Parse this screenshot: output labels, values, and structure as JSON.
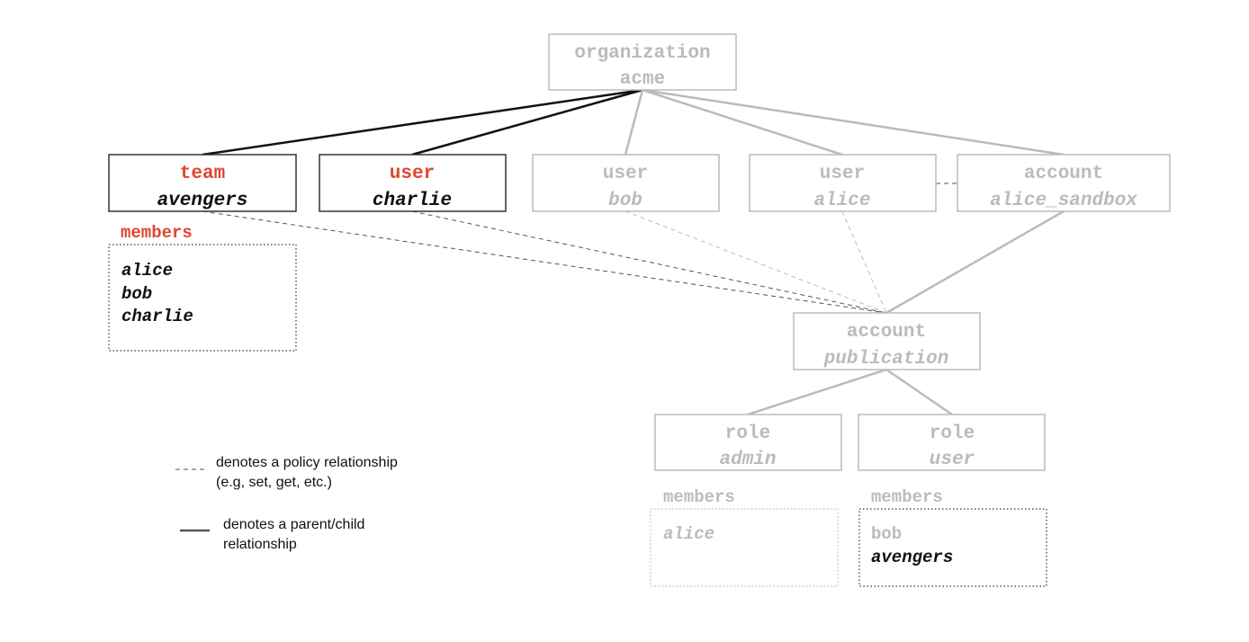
{
  "colors": {
    "accent": "#e0452f",
    "active": "#111111",
    "inactive": "#bbbbbb"
  },
  "nodes": {
    "organization": {
      "type": "organization",
      "name": "acme"
    },
    "team_avengers": {
      "type": "team",
      "name": "avengers",
      "members_label": "members",
      "members": [
        "alice",
        "bob",
        "charlie"
      ]
    },
    "user_charlie": {
      "type": "user",
      "name": "charlie"
    },
    "user_bob": {
      "type": "user",
      "name": "bob"
    },
    "user_alice": {
      "type": "user",
      "name": "alice"
    },
    "account_sandbox": {
      "type": "account",
      "name": "alice_sandbox"
    },
    "account_publication": {
      "type": "account",
      "name": "publication"
    },
    "role_admin": {
      "type": "role",
      "name": "admin",
      "members_label": "members",
      "members": [
        "alice"
      ]
    },
    "role_user": {
      "type": "role",
      "name": "user",
      "members_label": "members",
      "members": [
        "bob",
        "avengers"
      ]
    }
  },
  "legend": {
    "policy": [
      "denotes a policy relationship",
      "(e.g, set, get, etc.)"
    ],
    "parent": [
      "denotes a parent/child",
      "relationship"
    ]
  }
}
